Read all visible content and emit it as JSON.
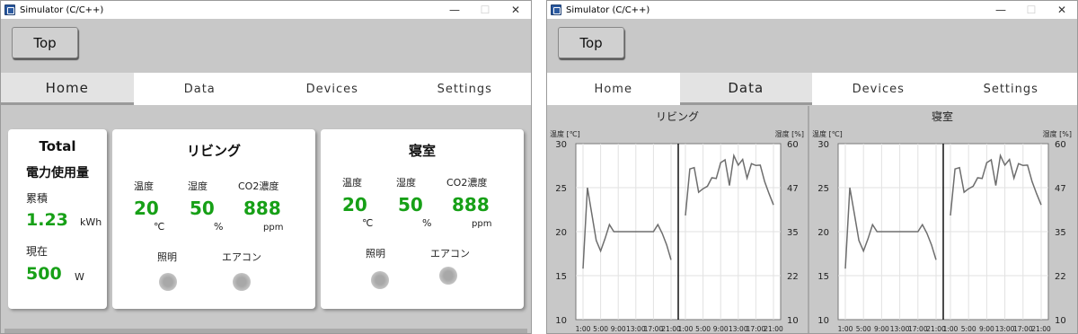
{
  "windows": [
    {
      "title": "Simulator (C/C++)",
      "controls": {
        "minimize": "—",
        "maximize": "☐",
        "close": "✕"
      },
      "top_button": "Top",
      "tabs": [
        "Home",
        "Data",
        "Devices",
        "Settings"
      ],
      "active_tab": 0,
      "total": {
        "title": "Total",
        "subtitle": "電力使用量",
        "cumulative_label": "累積",
        "cumulative_value": "1.23",
        "cumulative_unit": "kWh",
        "current_label": "現在",
        "current_value": "500",
        "current_unit": "W"
      },
      "rooms": [
        {
          "name": "リビング",
          "temp_label": "温度",
          "hum_label": "湿度",
          "co2_label": "CO2濃度",
          "temp": "20",
          "hum": "50",
          "co2": "888",
          "temp_unit": "℃",
          "hum_unit": "%",
          "co2_unit": "ppm",
          "light_label": "照明",
          "aircon_label": "エアコン"
        },
        {
          "name": "寝室",
          "temp_label": "温度",
          "hum_label": "湿度",
          "co2_label": "CO2濃度",
          "temp": "20",
          "hum": "50",
          "co2": "888",
          "temp_unit": "℃",
          "hum_unit": "%",
          "co2_unit": "ppm",
          "light_label": "照明",
          "aircon_label": "エアコン"
        }
      ]
    },
    {
      "title": "Simulator (C/C++)",
      "controls": {
        "minimize": "—",
        "maximize": "☐",
        "close": "✕"
      },
      "top_button": "Top",
      "tabs": [
        "Home",
        "Data",
        "Devices",
        "Settings"
      ],
      "active_tab": 1
    }
  ],
  "chart_data": [
    {
      "type": "line",
      "title": "リビング",
      "temp_axis_label": "温度 [℃]",
      "hum_axis_label": "湿度 [%]",
      "temp_ylim": [
        10,
        30
      ],
      "temp_ticks": [
        "30",
        "25",
        "20",
        "15",
        "10"
      ],
      "hum_ticks": [
        "60",
        "47",
        "35",
        "22",
        "10"
      ],
      "x_ticks": [
        "1:00",
        "5:00",
        "9:00",
        "13:00",
        "17:00",
        "21:00"
      ],
      "temperature": {
        "x": [
          1,
          2,
          3,
          4,
          5,
          6,
          7,
          8,
          9,
          10,
          11,
          12,
          13,
          14,
          15,
          16,
          17,
          18,
          19,
          20,
          21
        ],
        "y": [
          15.8,
          25,
          22,
          19,
          17.8,
          19.2,
          20.8,
          20,
          20,
          20,
          20,
          20,
          20,
          20,
          20,
          20,
          20,
          20.8,
          19.8,
          18.5,
          16.8
        ]
      },
      "humidity": {
        "x": [
          1,
          2,
          3,
          4,
          5,
          6,
          7,
          8,
          9,
          10,
          11,
          12,
          13,
          14,
          15,
          16,
          17,
          18,
          19,
          20,
          21
        ],
        "y": [
          39.6,
          52.8,
          53.2,
          46.2,
          47.2,
          47.9,
          50.3,
          50.1,
          54.6,
          55.4,
          48.1,
          56.6,
          53.9,
          55.5,
          50.2,
          54.3,
          53.8,
          53.9,
          49.2,
          45.8,
          42.6
        ]
      }
    },
    {
      "type": "line",
      "title": "寝室",
      "temp_axis_label": "温度 [℃]",
      "hum_axis_label": "湿度 [%]",
      "temp_ylim": [
        10,
        30
      ],
      "temp_ticks": [
        "30",
        "25",
        "20",
        "15",
        "10"
      ],
      "hum_ticks": [
        "60",
        "47",
        "35",
        "22",
        "10"
      ],
      "x_ticks": [
        "1:00",
        "5:00",
        "9:00",
        "13:00",
        "17:00",
        "21:00"
      ],
      "temperature": {
        "x": [
          1,
          2,
          3,
          4,
          5,
          6,
          7,
          8,
          9,
          10,
          11,
          12,
          13,
          14,
          15,
          16,
          17,
          18,
          19,
          20,
          21
        ],
        "y": [
          15.8,
          25,
          22,
          19,
          17.8,
          19.2,
          20.8,
          20,
          20,
          20,
          20,
          20,
          20,
          20,
          20,
          20,
          20,
          20.8,
          19.8,
          18.5,
          16.8
        ]
      },
      "humidity": {
        "x": [
          1,
          2,
          3,
          4,
          5,
          6,
          7,
          8,
          9,
          10,
          11,
          12,
          13,
          14,
          15,
          16,
          17,
          18,
          19,
          20,
          21
        ],
        "y": [
          39.6,
          52.8,
          53.2,
          46.2,
          47.2,
          47.9,
          50.3,
          50.1,
          54.6,
          55.4,
          48.1,
          56.6,
          53.9,
          55.5,
          50.2,
          54.3,
          53.8,
          53.9,
          49.2,
          45.8,
          42.6
        ]
      }
    }
  ]
}
